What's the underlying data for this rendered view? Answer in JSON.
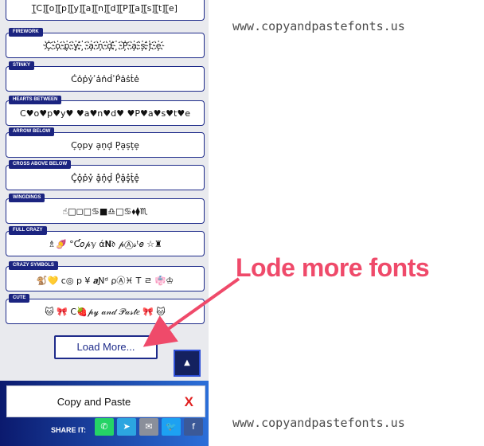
{
  "fonts": [
    {
      "tag": "",
      "sample": "[̲̅C][̲̅o][̲̅p][̲̅y][̲̅a][̲̅n][̲̅d][̲̅P][̲̅a][̲̅s][̲̅t][̲̅e]"
    },
    {
      "tag": "FIREWORK",
      "sample": "C҉o҉p҉y҉ ҉a҉n҉d҉ ҉P҉a҉s҉t҉e҉"
    },
    {
      "tag": "STINKY",
      "sample": "C̾o̾p̾y̾ ̾a̾n̾d̾ ̾P̾a̾s̾t̾e̾"
    },
    {
      "tag": "HEARTS BETWEEN",
      "sample": "C♥o♥p♥y♥ ♥a♥n♥d♥ ♥P♥a♥s♥t♥e"
    },
    {
      "tag": "ARROW BELOW",
      "sample": "C͎o͎p͎y͎ a͎n͎d͎ P͎a͎s͎t͎e͎"
    },
    {
      "tag": "CROSS ABOVE BELOW",
      "sample": "C͓̽o͓̽p͓̽y͓̽ a͓̽n͓̽d͓̽ P͓̽a͓̽s͓̽t͓̽e͓̽"
    },
    {
      "tag": "WINGDINGS",
      "sample": "☝︎□︎◻︎□︎♋︎■︎♎︎□︎♋︎⬧︎⧫︎♏︎"
    },
    {
      "tag": "FULL CRAZY",
      "sample": "♗🍠 °Ƈ𝑜𝓅𝕪 ά𝐍𝔡 𝓅Ⓐ𝓈ᵗ𝑒 ☆♜"
    },
    {
      "tag": "CRAZY SYMBOLS",
      "sample": "🐒💛 c◎ p ¥ 𝒂Ɲᵈ ρⒶ♓ T ㄹ 👘♔"
    },
    {
      "tag": "CUTE",
      "sample": "🐱 🎀 C🍓𝓅𝓎 𝒶𝓃𝒹 𝒫𝒶𝓈𝓉𝑒 🎀 🐱"
    }
  ],
  "load_more_label": "Load More...",
  "scroll_top_icon": "▲",
  "copy_bar": {
    "text": "Copy and Paste",
    "close": "X"
  },
  "share": {
    "label": "SHARE IT:",
    "buttons": [
      {
        "name": "whatsapp",
        "glyph": "✆",
        "color": "#25d366"
      },
      {
        "name": "telegram",
        "glyph": "➤",
        "color": "#2ca5e0"
      },
      {
        "name": "email",
        "glyph": "✉",
        "color": "#8a8f9a"
      },
      {
        "name": "twitter",
        "glyph": "🐦",
        "color": "#1da1f2"
      },
      {
        "name": "facebook",
        "glyph": "f",
        "color": "#3b5998"
      }
    ]
  },
  "watermark_text": "www.copyandpastefonts.us",
  "annotation": {
    "text": "Lode more fonts",
    "color": "#ef4a6a"
  }
}
